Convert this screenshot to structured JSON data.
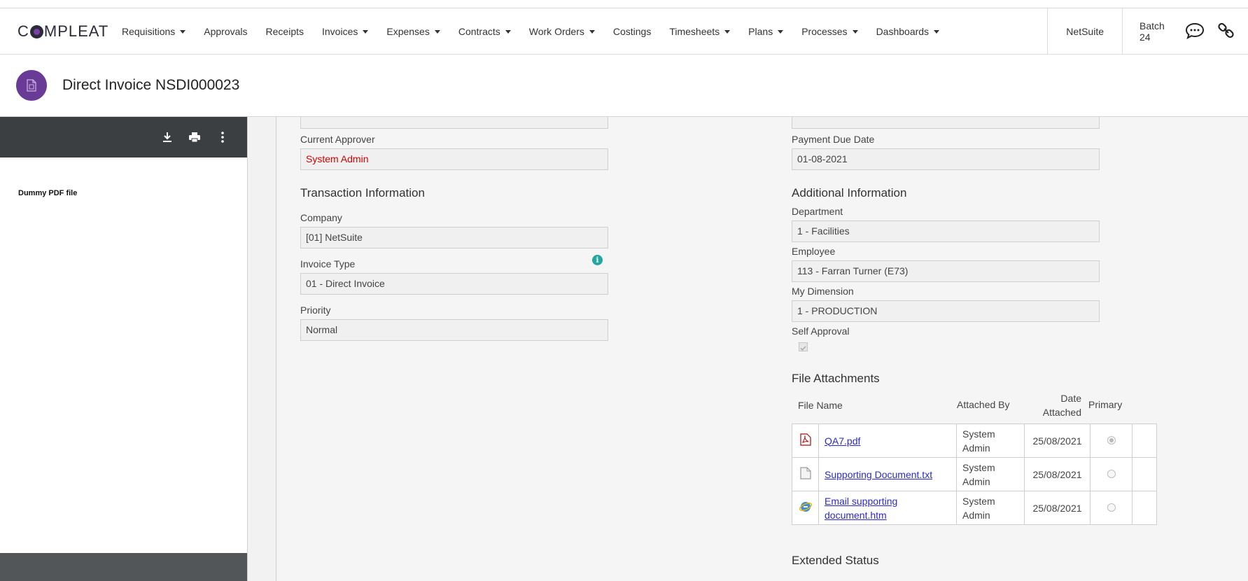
{
  "app": {
    "logo_text_a": "C",
    "logo_text_b": "MPLEAT"
  },
  "nav": {
    "items": [
      {
        "label": "Requisitions",
        "dropdown": true
      },
      {
        "label": "Approvals",
        "dropdown": false
      },
      {
        "label": "Receipts",
        "dropdown": false
      },
      {
        "label": "Invoices",
        "dropdown": true
      },
      {
        "label": "Expenses",
        "dropdown": true
      },
      {
        "label": "Contracts",
        "dropdown": true
      },
      {
        "label": "Work Orders",
        "dropdown": true
      },
      {
        "label": "Costings",
        "dropdown": false
      },
      {
        "label": "Timesheets",
        "dropdown": true
      },
      {
        "label": "Plans",
        "dropdown": true
      },
      {
        "label": "Processes",
        "dropdown": true
      },
      {
        "label": "Dashboards",
        "dropdown": true
      }
    ],
    "system": "NetSuite",
    "batch": "Batch 24"
  },
  "header": {
    "title": "Direct Invoice NSDI000023"
  },
  "pdf": {
    "content_text": "Dummy PDF file"
  },
  "form": {
    "current_approver_label": "Current Approver",
    "current_approver_value": "System Admin",
    "payment_due_label": "Payment Due Date",
    "payment_due_value": "01-08-2021",
    "transaction_title": "Transaction Information",
    "company_label": "Company",
    "company_value": "[01] NetSuite",
    "invoice_type_label": "Invoice Type",
    "invoice_type_value": "01 - Direct Invoice",
    "priority_label": "Priority",
    "priority_value": "Normal",
    "additional_title": "Additional Information",
    "department_label": "Department",
    "department_value": "1 - Facilities",
    "employee_label": "Employee",
    "employee_value": "113 - Farran Turner (E73)",
    "dimension_label": "My Dimension",
    "dimension_value": "1 - PRODUCTION",
    "self_approval_label": "Self Approval",
    "self_approval_checked": true
  },
  "attachments": {
    "title": "File Attachments",
    "headers": {
      "file_name": "File Name",
      "attached_by": "Attached By",
      "date_attached_1": "Date",
      "date_attached_2": "Attached",
      "primary": "Primary"
    },
    "rows": [
      {
        "icon": "pdf-file-icon",
        "name": "QA7.pdf",
        "by_1": "System",
        "by_2": "Admin",
        "date": "25/08/2021",
        "primary": true
      },
      {
        "icon": "text-file-icon",
        "name": "Supporting Document.txt",
        "by_1": "System",
        "by_2": "Admin",
        "date": "25/08/2021",
        "primary": false
      },
      {
        "icon": "html-file-icon",
        "name_1": "Email supporting",
        "name_2": "document.htm",
        "by_1": "System",
        "by_2": "Admin",
        "date": "25/08/2021",
        "primary": false
      }
    ]
  },
  "extended_status": {
    "title": "Extended Status"
  },
  "colors": {
    "accent": "#6a3a97",
    "approver_red": "#d40000",
    "link_blue": "#2a2ad0",
    "info_teal": "#24a7a0"
  }
}
